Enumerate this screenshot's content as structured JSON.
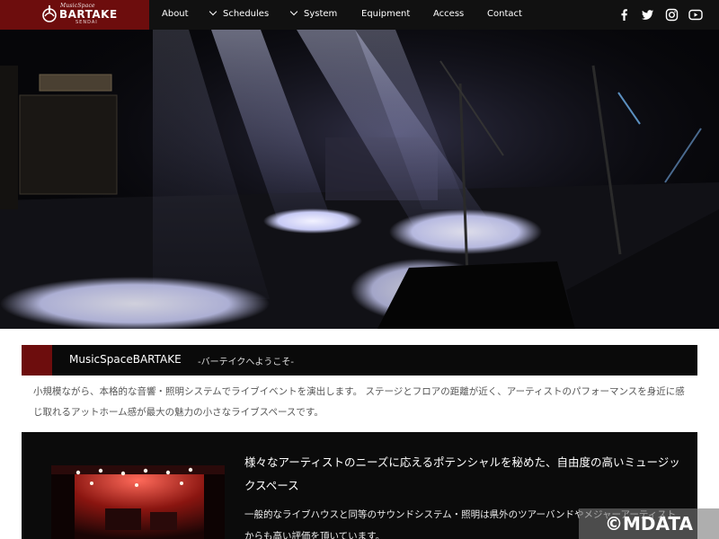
{
  "header": {
    "logo": {
      "small": "MusicSpace",
      "main": "BARTAKE",
      "sub": "SENDAI"
    },
    "nav": [
      {
        "label": "About",
        "has_dropdown": false
      },
      {
        "label": "Schedules",
        "has_dropdown": true
      },
      {
        "label": "System",
        "has_dropdown": true
      },
      {
        "label": "Equipment",
        "has_dropdown": false
      },
      {
        "label": "Access",
        "has_dropdown": false
      },
      {
        "label": "Contact",
        "has_dropdown": false
      }
    ],
    "social": [
      "facebook-icon",
      "twitter-icon",
      "instagram-icon",
      "youtube-icon"
    ]
  },
  "hero": {
    "alt_icon": "stage-photo"
  },
  "section": {
    "title": "MusicSpaceBARTAKE",
    "subtitle": "-バーテイクへようこそ-",
    "intro": "小規模ながら、本格的な音響・照明システムでライブイベントを演出します。 ステージとフロアの距離が近く、アーティストのパフォーマンスを身近に感じ取れるアットホーム感が最大の魅力の小さなライブスペースです。"
  },
  "feature": {
    "heading": "様々なアーティストのニーズに応えるポテンシャルを秘めた、自由度の高いミュージックスペース",
    "body": "一般的なライブハウスと同等のサウンドシステム・照明は県外のツアーバンドやメジャーアーティストからも高い評価を頂いています。"
  },
  "watermark": "©MDATA",
  "colors": {
    "brand": "#6d0d0d",
    "header_bg": "#111111",
    "section_bg": "#0b0b0b"
  }
}
